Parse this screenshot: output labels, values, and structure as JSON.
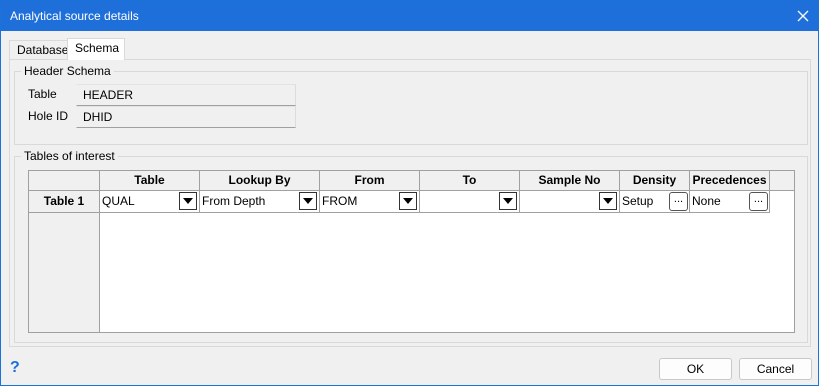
{
  "window": {
    "title": "Analytical source details"
  },
  "tabs": [
    {
      "label": "Database",
      "active": false
    },
    {
      "label": "Schema",
      "active": true
    }
  ],
  "header_schema": {
    "label": "Header Schema",
    "table_label": "Table",
    "table_value": "HEADER",
    "hole_id_label": "Hole ID",
    "hole_id_value": "DHID"
  },
  "tables_of_interest": {
    "label": "Tables of interest",
    "columns": [
      "Table",
      "Lookup By",
      "From",
      "To",
      "Sample No",
      "Density",
      "Precedences"
    ],
    "rows": [
      {
        "header": "Table 1",
        "table": "QUAL",
        "lookup_by": "From Depth",
        "from": "FROM",
        "to": "",
        "sample_no": "",
        "density": "Setup",
        "precedences": "None"
      }
    ],
    "ellipsis": "..."
  },
  "footer": {
    "help": "?",
    "ok": "OK",
    "cancel": "Cancel"
  },
  "icons": {
    "close": "close-icon",
    "dropdown": "chevron-down-icon",
    "help": "help-icon"
  },
  "colors": {
    "titlebar": "#1e6fd9",
    "background": "#f0f0f0"
  }
}
